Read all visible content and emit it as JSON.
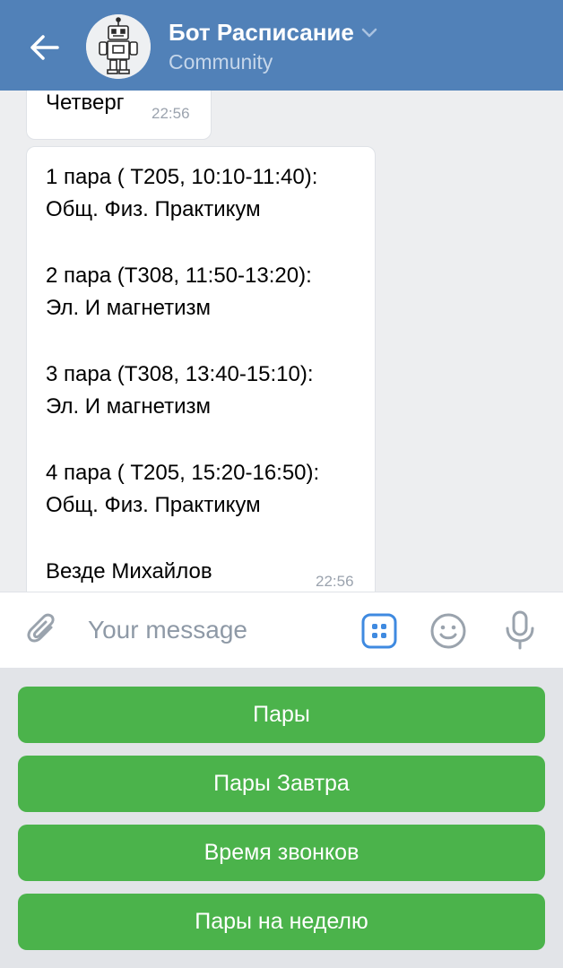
{
  "header": {
    "title": "Бот Расписание",
    "subtitle": "Community",
    "back_icon": "arrow-left-icon",
    "chevron_icon": "chevron-down-icon"
  },
  "messages": [
    {
      "text": "Четверг",
      "time": "22:56"
    },
    {
      "lines": [
        "1 пара ( Т205, 10:10-11:40):",
        "Общ. Физ. Практикум",
        "2 пара (Т308, 11:50-13:20):",
        "Эл. И магнетизм",
        "3 пара (Т308, 13:40-15:10):",
        "Эл. И магнетизм",
        "4 пара ( Т205, 15:20-16:50):",
        "Общ. Физ. Практикум",
        "Везде Михайлов"
      ],
      "time": "22:56"
    }
  ],
  "composer": {
    "placeholder": "Your message",
    "value": "",
    "icons": [
      "paperclip-icon",
      "bot-keyboard-icon",
      "emoji-icon",
      "microphone-icon"
    ]
  },
  "keyboard": {
    "buttons": [
      "Пары",
      "Пары Завтра",
      "Время звонков",
      "Пары на неделю"
    ]
  },
  "colors": {
    "header_bg": "#5181b8",
    "button_green": "#4bb34b",
    "accent_blue": "#3f8ae0",
    "chat_bg": "#edeef0"
  }
}
